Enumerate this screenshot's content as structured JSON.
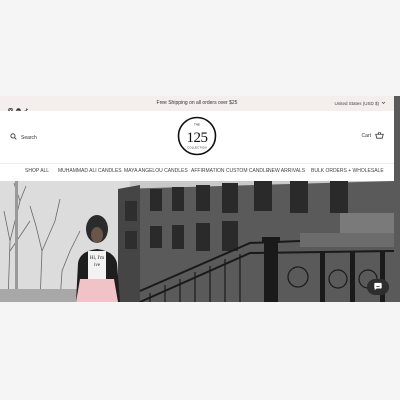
{
  "announcement": {
    "text": "Free Shipping on all orders over $25",
    "currency": "United States (USD $)"
  },
  "social": [
    "instagram-icon",
    "pinterest-icon",
    "tiktok-icon"
  ],
  "header": {
    "search_label": "Search",
    "cart_label": "Cart",
    "logo": {
      "top_text": "THE",
      "number": "125",
      "bottom_text": "COLLECTION"
    }
  },
  "nav": {
    "items": [
      "SHOP ALL",
      "MUHAMMAD ALI CANDLES",
      "MAYA ANGELOU CANDLES",
      "AFFIRMATION CUSTOM CANDLE",
      "NEW ARRIVALS",
      "BULK ORDERS + WHOLESALE"
    ]
  },
  "hero": {
    "shirt_text_line1": "Hi, I'm",
    "shirt_text_line2": "ive"
  },
  "colors": {
    "announcement_bg": "#f4eeed",
    "text": "#222222",
    "chat_bg": "#2e2e2e"
  }
}
